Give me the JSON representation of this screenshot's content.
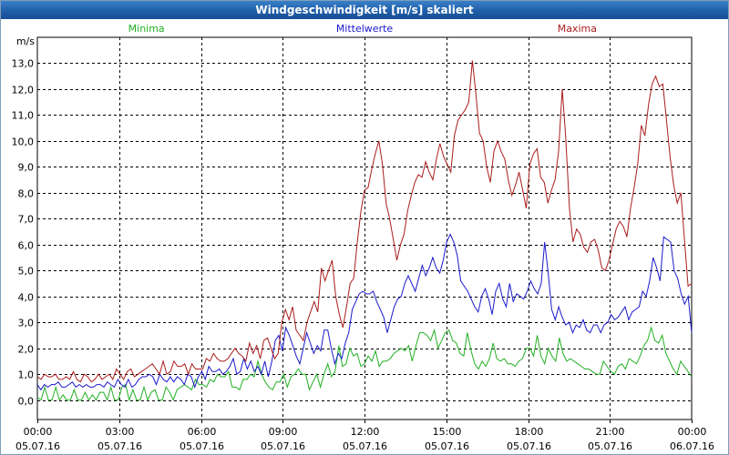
{
  "window": {
    "title": "Windgeschwindigkeit [m/s] skaliert"
  },
  "chart_data": {
    "type": "line",
    "unit_label": "m/s",
    "ylim": [
      -0.75,
      14.0
    ],
    "yticks": [
      "0,0",
      "1,0",
      "2,0",
      "3,0",
      "4,0",
      "5,0",
      "6,0",
      "7,0",
      "8,0",
      "9,0",
      "10,0",
      "11,0",
      "12,0",
      "13,0"
    ],
    "xlim_hours": [
      0,
      24
    ],
    "grid": true,
    "xticks": [
      {
        "time": "00:00",
        "date": "05.07.16",
        "hour": 0
      },
      {
        "time": "03:00",
        "date": "05.07.16",
        "hour": 3
      },
      {
        "time": "06:00",
        "date": "05.07.16",
        "hour": 6
      },
      {
        "time": "09:00",
        "date": "05.07.16",
        "hour": 9
      },
      {
        "time": "12:00",
        "date": "05.07.16",
        "hour": 12
      },
      {
        "time": "15:00",
        "date": "05.07.16",
        "hour": 15
      },
      {
        "time": "18:00",
        "date": "05.07.16",
        "hour": 18
      },
      {
        "time": "21:00",
        "date": "05.07.16",
        "hour": 21
      },
      {
        "time": "00:00",
        "date": "06.07.16",
        "hour": 24
      }
    ],
    "series": [
      {
        "name": "Minima",
        "color": "#22b022",
        "legend_pos": "left",
        "values": [
          0.1,
          0.0,
          0.5,
          0.0,
          0.0,
          0.5,
          0.0,
          0.2,
          0.0,
          0.0,
          0.4,
          0.0,
          0.0,
          0.3,
          0.0,
          0.2,
          0.0,
          0.3,
          0.3,
          0.0,
          0.5,
          0.0,
          0.0,
          0.5,
          0.6,
          0.0,
          0.4,
          0.0,
          0.0,
          0.5,
          0.0,
          0.3,
          0.4,
          0.0,
          0.0,
          0.5,
          0.3,
          0.0,
          0.4,
          0.5,
          0.6,
          0.5,
          0.4,
          0.8,
          0.6,
          0.6,
          0.5,
          0.8,
          0.7,
          1.0,
          0.9,
          0.9,
          1.1,
          0.5,
          0.5,
          0.4,
          0.8,
          0.8,
          1.0,
          0.9,
          1.5,
          1.0,
          0.7,
          0.5,
          0.4,
          0.7,
          0.7,
          1.0,
          0.5,
          0.9,
          1.0,
          1.2,
          1.0,
          1.0,
          0.4,
          0.7,
          1.0,
          0.5,
          1.0,
          1.4,
          0.9,
          1.1,
          2.1,
          1.3,
          1.4,
          2.0,
          1.7,
          1.8,
          1.3,
          1.4,
          1.7,
          1.5,
          1.9,
          1.3,
          1.5,
          1.5,
          1.6,
          1.8,
          1.9,
          2.0,
          1.9,
          2.1,
          1.5,
          2.1,
          2.6,
          2.6,
          2.5,
          2.3,
          2.7,
          2.0,
          2.3,
          2.6,
          2.7,
          2.3,
          2.2,
          1.8,
          1.7,
          2.6,
          1.9,
          1.4,
          1.2,
          1.5,
          1.3,
          1.6,
          2.2,
          1.6,
          1.5,
          1.6,
          1.4,
          1.4,
          1.3,
          1.5,
          1.6,
          2.0,
          2.0,
          1.7,
          2.5,
          1.7,
          1.4,
          2.0,
          1.7,
          1.5,
          2.4,
          1.8,
          1.5,
          1.6,
          1.5,
          1.4,
          1.3,
          1.2,
          1.2,
          1.1,
          1.0,
          1.0,
          1.5,
          1.3,
          1.1,
          1.0,
          1.3,
          1.4,
          1.2,
          1.6,
          1.5,
          1.4,
          1.7,
          2.1,
          2.3,
          2.8,
          2.3,
          2.2,
          2.5,
          1.8,
          1.5,
          1.2,
          1.0,
          1.5,
          1.3,
          1.1,
          0.9
        ]
      },
      {
        "name": "Mittelwerte",
        "color": "#1a1acc",
        "legend_pos": "center",
        "values": [
          0.6,
          0.4,
          0.6,
          0.5,
          0.6,
          0.6,
          0.7,
          0.5,
          0.5,
          0.6,
          0.7,
          0.5,
          0.6,
          0.5,
          0.6,
          0.5,
          0.5,
          0.6,
          0.6,
          0.5,
          0.7,
          0.6,
          0.5,
          0.8,
          0.6,
          0.5,
          0.8,
          0.5,
          0.6,
          0.8,
          0.9,
          0.9,
          1.0,
          0.9,
          0.6,
          1.0,
          0.8,
          0.7,
          0.9,
          0.7,
          0.9,
          0.8,
          0.6,
          1.0,
          0.9,
          0.5,
          0.9,
          1.1,
          0.8,
          1.3,
          1.1,
          1.1,
          1.2,
          1.0,
          1.1,
          1.3,
          1.6,
          1.0,
          1.1,
          1.6,
          1.2,
          1.5,
          1.1,
          1.3,
          1.0,
          1.5,
          0.9,
          1.5,
          2.3,
          2.5,
          1.9,
          2.8,
          2.5,
          2.1,
          1.7,
          1.4,
          2.0,
          2.6,
          2.2,
          1.8,
          2.1,
          1.9,
          2.7,
          2.7,
          2.0,
          1.4,
          1.8,
          1.6,
          2.2,
          2.6,
          3.5,
          3.8,
          4.1,
          4.2,
          4.1,
          4.1,
          4.2,
          3.8,
          3.5,
          3.2,
          2.6,
          3.1,
          3.6,
          3.9,
          4.0,
          4.5,
          4.8,
          4.5,
          4.2,
          4.7,
          5.2,
          4.8,
          5.1,
          5.5,
          5.1,
          4.9,
          5.4,
          6.1,
          6.4,
          6.1,
          5.6,
          4.6,
          4.4,
          4.2,
          3.9,
          3.6,
          3.4,
          4.0,
          4.3,
          3.9,
          3.3,
          4.2,
          4.5,
          3.9,
          3.6,
          4.5,
          3.8,
          4.1,
          4.0,
          3.9,
          4.2,
          4.6,
          4.3,
          4.1,
          4.5,
          6.1,
          4.9,
          3.5,
          3.1,
          3.6,
          3.2,
          2.9,
          3.0,
          2.6,
          2.9,
          2.8,
          3.1,
          2.7,
          2.6,
          2.9,
          2.9,
          2.6,
          2.9,
          3.0,
          3.3,
          3.1,
          3.2,
          3.4,
          3.6,
          3.1,
          3.4,
          3.5,
          3.6,
          4.2,
          4.0,
          4.6,
          5.5,
          5.1,
          4.6,
          6.3,
          6.2,
          6.1,
          5.0,
          4.7,
          4.1,
          3.7,
          4.0,
          2.6
        ]
      },
      {
        "name": "Maxima",
        "color": "#aa1c1c",
        "legend_pos": "right",
        "values": [
          0.9,
          0.8,
          1.0,
          0.9,
          0.9,
          1.0,
          0.8,
          0.8,
          0.9,
          0.8,
          1.1,
          0.8,
          0.7,
          1.0,
          0.9,
          0.7,
          0.8,
          1.0,
          0.8,
          0.9,
          1.0,
          0.8,
          1.2,
          1.0,
          0.8,
          1.1,
          1.2,
          0.9,
          1.0,
          1.1,
          1.2,
          1.3,
          1.4,
          1.2,
          1.0,
          1.5,
          1.0,
          1.1,
          1.5,
          1.3,
          1.3,
          1.4,
          1.0,
          1.4,
          1.2,
          1.2,
          1.2,
          1.6,
          1.5,
          1.8,
          1.6,
          1.5,
          1.5,
          1.6,
          1.8,
          2.0,
          1.8,
          1.7,
          1.5,
          2.2,
          1.8,
          2.1,
          1.6,
          2.3,
          2.4,
          2.0,
          1.6,
          1.8,
          3.0,
          3.5,
          3.1,
          3.6,
          2.7,
          2.5,
          2.3,
          3.0,
          3.4,
          3.8,
          3.4,
          5.1,
          4.6,
          5.0,
          5.4,
          4.0,
          3.3,
          2.8,
          3.6,
          4.5,
          4.7,
          6.1,
          7.3,
          8.1,
          8.2,
          8.9,
          9.5,
          10.0,
          9.1,
          7.6,
          7.0,
          6.2,
          5.4,
          6.0,
          6.4,
          7.3,
          7.9,
          8.4,
          8.7,
          8.6,
          9.2,
          8.8,
          8.5,
          9.3,
          9.9,
          9.4,
          9.1,
          8.8,
          10.2,
          10.8,
          11.0,
          11.2,
          11.5,
          13.1,
          11.8,
          10.3,
          10.0,
          9.0,
          8.4,
          9.6,
          10.0,
          9.6,
          9.3,
          8.5,
          7.9,
          8.3,
          8.8,
          8.1,
          7.4,
          9.1,
          9.5,
          9.7,
          8.6,
          8.4,
          7.6,
          8.1,
          8.5,
          9.6,
          12.0,
          10.1,
          7.4,
          6.1,
          6.6,
          6.4,
          5.9,
          5.7,
          6.1,
          6.2,
          5.8,
          5.1,
          5.0,
          5.4,
          6.0,
          6.6,
          6.9,
          6.7,
          6.3,
          7.4,
          8.2,
          9.1,
          10.6,
          10.2,
          11.4,
          12.2,
          12.5,
          12.1,
          12.2,
          10.8,
          9.4,
          8.3,
          7.6,
          8.0,
          6.2,
          4.4,
          4.5
        ]
      }
    ]
  }
}
